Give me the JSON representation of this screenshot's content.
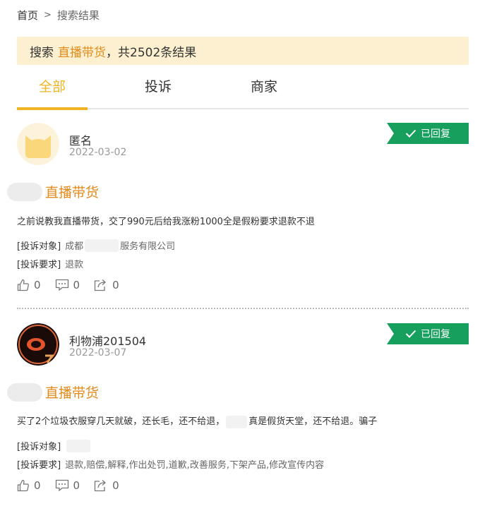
{
  "breadcrumb": {
    "home": "首页",
    "separator": ">",
    "current": "搜索结果"
  },
  "search": {
    "prefix": "搜索",
    "keyword": "直播带货",
    "suffix": "，共2502条结果"
  },
  "tabs": [
    {
      "label": "全部",
      "active": true
    },
    {
      "label": "投诉",
      "active": false
    },
    {
      "label": "商家",
      "active": false
    }
  ],
  "colors": {
    "accent": "#f0b322",
    "keyword": "#e38a1a",
    "badge": "#17a05d",
    "search_bg": "#fdf0d0"
  },
  "results": [
    {
      "user": "匿名",
      "date": "2022-03-02",
      "badge": "已回复",
      "title": "直播带货",
      "description": "之前说教我直播带货，交了990元后给我涨粉1000全是假粉要求退款不退",
      "target_label": "[投诉对象]",
      "target_value_prefix": "成都",
      "target_value_suffix": "服务有限公司",
      "request_label": "[投诉要求]",
      "request_value": "退款",
      "likes": "0",
      "comments": "0",
      "shares": "0"
    },
    {
      "user": "利物浦201504",
      "date": "2022-03-07",
      "badge": "已回复",
      "title": "直播带货",
      "description_part1": "买了2个垃圾衣服穿几天就破，还长毛，还不给退，",
      "description_part2": "真是假货天堂，还不给退。骗子",
      "target_label": "[投诉对象]",
      "request_label": "[投诉要求]",
      "request_value": "退款,赔偿,解释,作出处罚,道歉,改善服务,下架产品,修改宣传内容",
      "likes": "0",
      "comments": "0",
      "shares": "0"
    }
  ]
}
